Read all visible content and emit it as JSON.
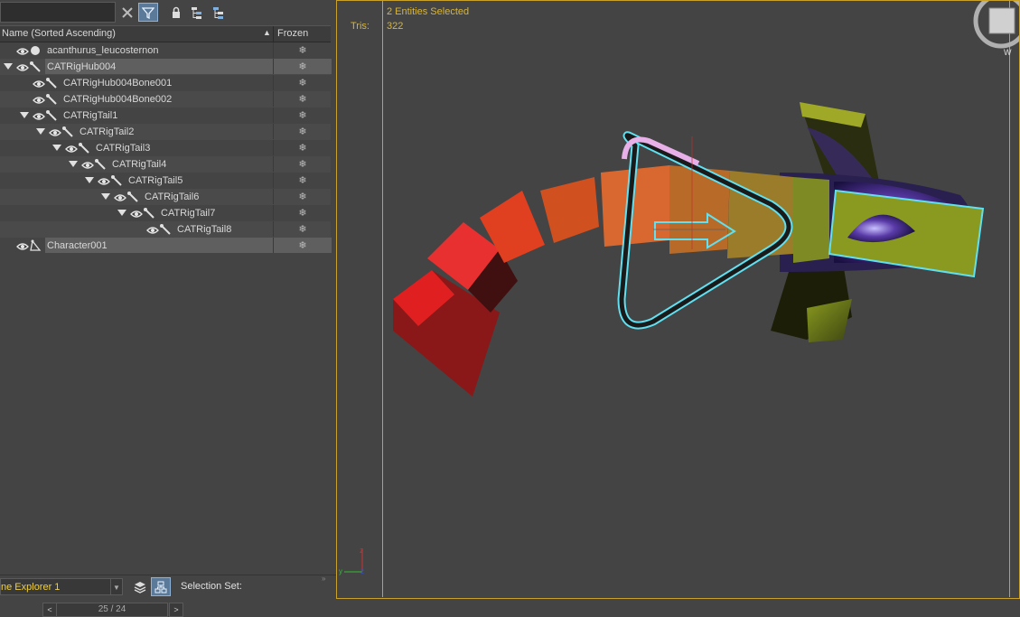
{
  "toolbar": {
    "search_value": "",
    "icons": [
      "close-icon",
      "filter-icon",
      "lock-icon",
      "hierarchy-icon",
      "hierarchy-alt-icon"
    ]
  },
  "explorer": {
    "columns": {
      "name": "Name (Sorted Ascending)",
      "sort_indicator": "▲",
      "frozen": "Frozen"
    },
    "rows": [
      {
        "label": "acanthurus_leucosternon",
        "depth": 0,
        "expandable": false,
        "icon": "sphere-icon",
        "frozen_glyph": "❄",
        "selected": false
      },
      {
        "label": "CATRigHub004",
        "depth": 0,
        "expandable": true,
        "icon": "bone-icon",
        "frozen_glyph": "❄",
        "selected": true
      },
      {
        "label": "CATRigHub004Bone001",
        "depth": 1,
        "expandable": false,
        "icon": "bone-icon",
        "frozen_glyph": "❄",
        "selected": false
      },
      {
        "label": "CATRigHub004Bone002",
        "depth": 1,
        "expandable": false,
        "icon": "bone-icon",
        "frozen_glyph": "❄",
        "selected": false
      },
      {
        "label": "CATRigTail1",
        "depth": 1,
        "expandable": true,
        "icon": "bone-icon",
        "frozen_glyph": "❄",
        "selected": false
      },
      {
        "label": "CATRigTail2",
        "depth": 2,
        "expandable": true,
        "icon": "bone-icon",
        "frozen_glyph": "❄",
        "selected": false
      },
      {
        "label": "CATRigTail3",
        "depth": 3,
        "expandable": true,
        "icon": "bone-icon",
        "frozen_glyph": "❄",
        "selected": false
      },
      {
        "label": "CATRigTail4",
        "depth": 4,
        "expandable": true,
        "icon": "bone-icon",
        "frozen_glyph": "❄",
        "selected": false
      },
      {
        "label": "CATRigTail5",
        "depth": 5,
        "expandable": true,
        "icon": "bone-icon",
        "frozen_glyph": "❄",
        "selected": false
      },
      {
        "label": "CATRigTail6",
        "depth": 6,
        "expandable": true,
        "icon": "bone-icon",
        "frozen_glyph": "❄",
        "selected": false
      },
      {
        "label": "CATRigTail7",
        "depth": 7,
        "expandable": true,
        "icon": "bone-icon",
        "frozen_glyph": "❄",
        "selected": false
      },
      {
        "label": "CATRigTail8",
        "depth": 8,
        "expandable": false,
        "icon": "bone-icon",
        "frozen_glyph": "❄",
        "selected": false
      },
      {
        "label": "Character001",
        "depth": 0,
        "expandable": false,
        "icon": "character-icon",
        "frozen_glyph": "❄",
        "selected": true
      }
    ]
  },
  "bottom": {
    "explorer_name": "ne Explorer 1",
    "selection_set_label": "Selection Set:",
    "collapse_glyph": "»"
  },
  "pager": {
    "prev": "<",
    "value": "25 / 24",
    "next": ">"
  },
  "viewport": {
    "selection_info": "2 Entities Selected",
    "tris_label": "Tris:",
    "tris_value": "322",
    "accent": "#c9a227",
    "viewcube_label": "W"
  }
}
